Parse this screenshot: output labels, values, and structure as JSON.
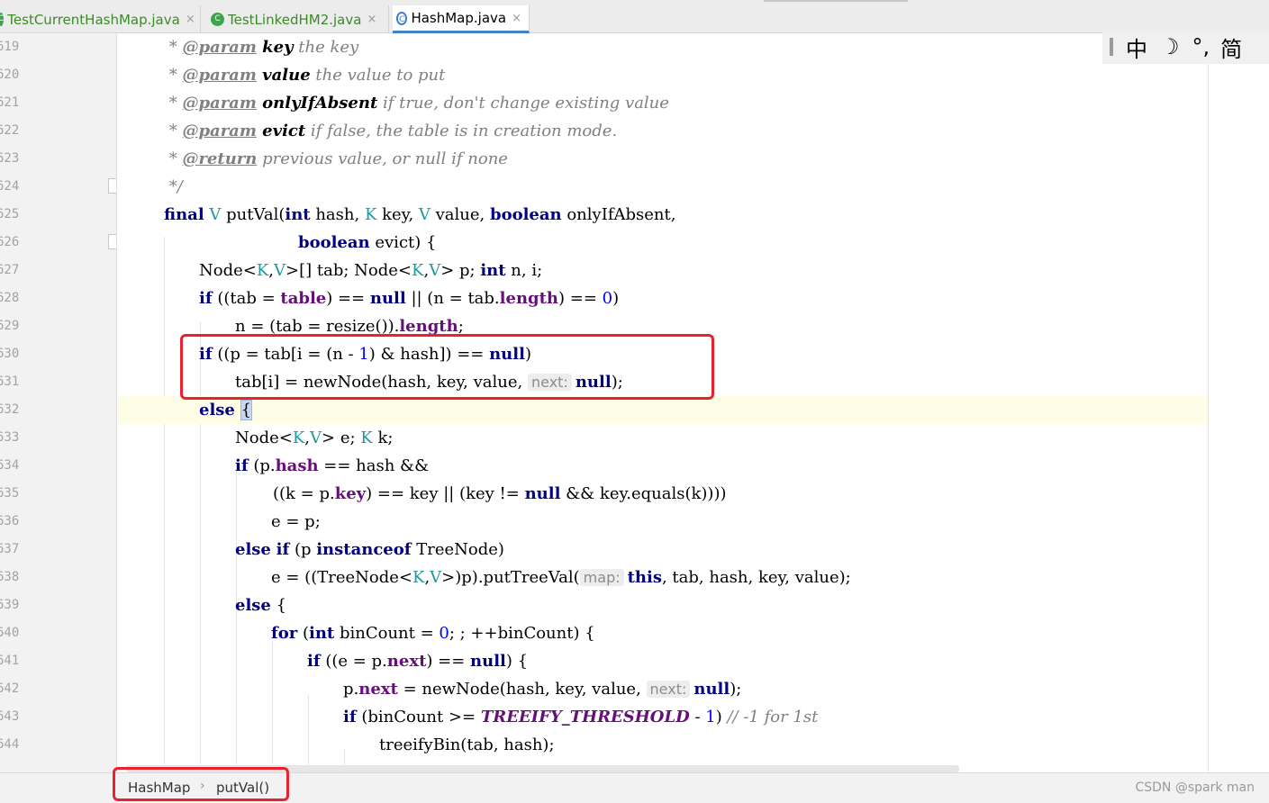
{
  "tabs": [
    {
      "label": "TestCurrentHashMap.java",
      "close": "×",
      "icon": "class-icon"
    },
    {
      "label": "TestLinkedHM2.java",
      "close": "×",
      "icon": "class-icon"
    },
    {
      "label": "HashMap.java",
      "close": "×",
      "icon": "class-icon",
      "active": true
    }
  ],
  "ime": {
    "mode": "中",
    "moon": "☽",
    "punct": "°,",
    "script": "简"
  },
  "gutter": {
    "line_numbers": [
      "619",
      "620",
      "621",
      "622",
      "623",
      "624",
      "625",
      "626",
      "627",
      "628",
      "629",
      "630",
      "631",
      "632",
      "633",
      "634",
      "635",
      "636",
      "637",
      "638",
      "639",
      "640",
      "641",
      "642",
      "643",
      "644"
    ]
  },
  "code": {
    "l619_star": " * ",
    "l619_tag": "@param",
    "l619_name": " key",
    "l619_text": " the key",
    "l620_star": " * ",
    "l620_tag": "@param",
    "l620_name": " value",
    "l620_text": " the value to put",
    "l621_star": " * ",
    "l621_tag": "@param",
    "l621_name": " onlyIfAbsent",
    "l621_text": " if true, don't change existing value",
    "l622_star": " * ",
    "l622_tag": "@param",
    "l622_name": " evict",
    "l622_text": " if false, the table is in creation mode.",
    "l623_star": " * ",
    "l623_tag": "@return",
    "l623_text": " previous value, or null if none",
    "l624": " */",
    "l625": [
      "final",
      " ",
      "V",
      " putVal(",
      "int",
      " hash, ",
      "K",
      " key, ",
      "V",
      " value, ",
      "boolean",
      " onlyIfAbsent,"
    ],
    "l626": [
      "boolean",
      " evict) {"
    ],
    "l627": [
      "Node<",
      "K",
      ",",
      "V",
      ">[] tab; Node<",
      "K",
      ",",
      "V",
      "> p; ",
      "int",
      " n, i;"
    ],
    "l628": [
      "if",
      " ((tab = ",
      "table",
      ") == ",
      "null",
      " || (n = tab.",
      "length",
      ") == ",
      "0",
      ")"
    ],
    "l629": [
      "n = (tab = resize()).",
      "length",
      ";"
    ],
    "l630": [
      "if",
      " ((p = tab[i = (n - ",
      "1",
      ") & hash]) == ",
      "null",
      ")"
    ],
    "l631": [
      "tab[i] = newNode(hash, key, value, ",
      "next:",
      "null",
      ");"
    ],
    "l632": [
      "else",
      " ",
      "{"
    ],
    "l633": [
      "Node<",
      "K",
      ",",
      "V",
      "> e; ",
      "K",
      " k;"
    ],
    "l634": [
      "if",
      " (p.",
      "hash",
      " == hash &&"
    ],
    "l635": [
      "((k = p.",
      "key",
      ") == key || (key != ",
      "null",
      " && key.equals(k))))"
    ],
    "l636": [
      "e = p;"
    ],
    "l637": [
      "else",
      " ",
      "if",
      " (p ",
      "instanceof",
      " TreeNode)"
    ],
    "l638": [
      "e = ((TreeNode<",
      "K",
      ",",
      "V",
      ">)p).putTreeVal(",
      "map:",
      "this",
      ", tab, hash, key, value);"
    ],
    "l639": [
      "else",
      " {"
    ],
    "l640": [
      "for",
      " (",
      "int",
      " binCount = ",
      "0",
      "; ; ++binCount) {"
    ],
    "l641": [
      "if",
      " ((e = p.",
      "next",
      ") == ",
      "null",
      ") {"
    ],
    "l642": [
      "p.",
      "next",
      " = newNode(hash, key, value, ",
      "next:",
      "null",
      ");"
    ],
    "l643": [
      "if",
      " (binCount >= ",
      "TREEIFY_THRESHOLD",
      " - ",
      "1",
      ") ",
      "// -1 for 1st"
    ],
    "l644": [
      "treeifyBin(tab, hash);"
    ]
  },
  "breadcrumb": {
    "class": "HashMap",
    "separator": "›",
    "method": "putVal()"
  },
  "watermark": "CSDN @spark man",
  "colors": {
    "keyword": "#000080",
    "type_param": "#20999d",
    "field": "#660e7a",
    "number": "#0000ff",
    "comment": "#808080",
    "annotation_box": "#e8232f"
  }
}
